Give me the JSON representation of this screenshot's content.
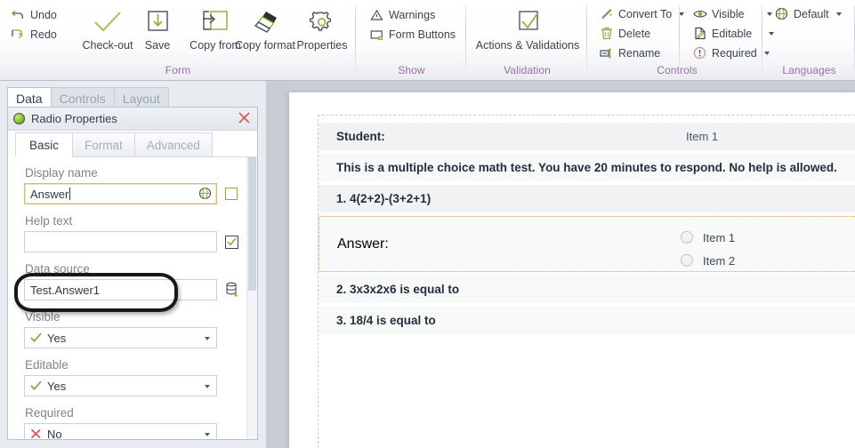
{
  "ribbon": {
    "groups": [
      {
        "title": "Form",
        "small_buttons": [
          {
            "label": "Undo",
            "icon": "undo-icon"
          },
          {
            "label": "Redo",
            "icon": "redo-icon"
          }
        ],
        "big_buttons": [
          {
            "label": "Check-out",
            "icon": "checkmark-icon"
          },
          {
            "label": "Save",
            "icon": "save-download-icon"
          },
          {
            "label": "Copy from",
            "icon": "copy-from-icon"
          },
          {
            "label": "Copy format",
            "icon": "paintbrush-icon"
          },
          {
            "label": "Properties",
            "icon": "gear-icon"
          }
        ]
      },
      {
        "title": "Show",
        "small_buttons": [
          {
            "label": "Warnings",
            "icon": "warning-triangle-icon"
          },
          {
            "label": "Form Buttons",
            "icon": "form-buttons-icon"
          }
        ]
      },
      {
        "title": "Validation",
        "big_buttons": [
          {
            "label": "Actions & Validations",
            "icon": "checkbox-check-icon"
          }
        ]
      },
      {
        "title": "Controls",
        "col_a": [
          {
            "label": "Convert To",
            "icon": "magic-wand-icon",
            "caret": true
          },
          {
            "label": "Delete",
            "icon": "trash-icon",
            "caret": false
          },
          {
            "label": "Rename",
            "icon": "rename-icon",
            "caret": false
          }
        ],
        "col_b": [
          {
            "label": "Visible",
            "icon": "eye-icon",
            "caret": true
          },
          {
            "label": "Editable",
            "icon": "edit-page-icon",
            "caret": true
          },
          {
            "label": "Required",
            "icon": "exclamation-circle-icon",
            "caret": true
          }
        ]
      },
      {
        "title": "Languages",
        "col_a": [
          {
            "label": "Default",
            "icon": "globe-icon",
            "caret": true
          }
        ]
      }
    ]
  },
  "left_panel": {
    "tabs": [
      {
        "label": "Data",
        "active": true
      },
      {
        "label": "Controls",
        "active": false
      },
      {
        "label": "Layout",
        "active": false
      }
    ],
    "properties": {
      "title": "Radio Properties",
      "icon": "radio-green-circle-icon",
      "close_icon": "close-x-icon",
      "subtabs": [
        {
          "label": "Basic",
          "active": true
        },
        {
          "label": "Format",
          "active": false
        },
        {
          "label": "Advanced",
          "active": false
        }
      ],
      "fields": [
        {
          "label": "Display name",
          "value": "Answer",
          "side_icon": "globe-icon",
          "trailing": "olive-checkbox",
          "highlighted": true
        },
        {
          "label": "Help text",
          "value": "",
          "trailing": "green-check-box"
        },
        {
          "label": "Data source",
          "value": "Test.Answer1",
          "side_icon": "database-add-icon"
        },
        {
          "label": "Visible",
          "value": "Yes",
          "type": "select",
          "mark": "check"
        },
        {
          "label": "Editable",
          "value": "Yes",
          "type": "select",
          "mark": "check"
        },
        {
          "label": "Required",
          "value": "No",
          "type": "select",
          "mark": "cross"
        }
      ]
    }
  },
  "form_preview": {
    "rows": [
      {
        "id": "student",
        "label": "Student:",
        "right_value": "Item 1",
        "shade": "dark"
      },
      {
        "id": "instructions",
        "label": "This is a multiple choice math test. You have 20 minutes to respond. No help is allowed.",
        "right_value": "",
        "shade": "light"
      },
      {
        "id": "q1",
        "label": "1. 4(2+2)-(3+2+1)",
        "right_value": "",
        "shade": "dark"
      }
    ],
    "answer_row": {
      "label": "Answer:",
      "options": [
        {
          "label": "Item 1"
        },
        {
          "label": "Item 2"
        }
      ]
    },
    "rows_after": [
      {
        "id": "q2",
        "label": "2. 3x3x2x6 is equal to",
        "shade": "light"
      },
      {
        "id": "q3",
        "label": "3. 18/4 is equal to",
        "shade": "light"
      }
    ]
  },
  "colors": {
    "group_title": "#9a6fa3",
    "accent_green": "#8fad33",
    "selection_border": "#e0a83c",
    "close_red": "#d9534f",
    "annotation": "#16181a"
  }
}
